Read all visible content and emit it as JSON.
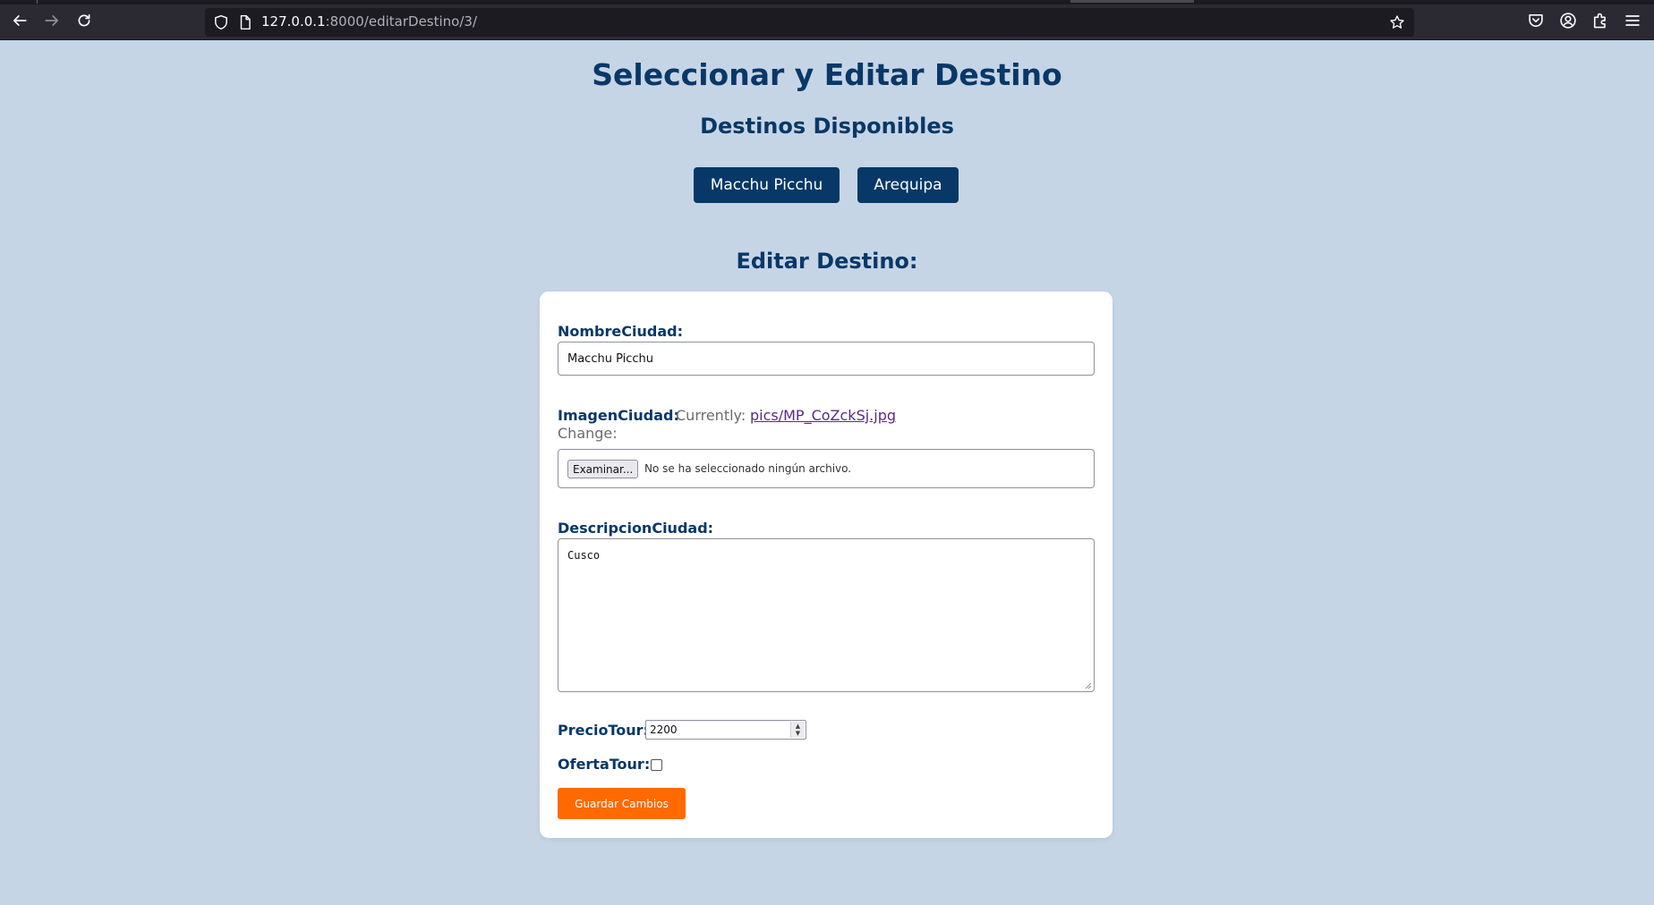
{
  "browser": {
    "url_host": "127.0.0.1",
    "url_rest": ":8000/editarDestino/3/",
    "icons": [
      "back-arrow-icon",
      "forward-arrow-icon",
      "reload-icon",
      "shield-icon",
      "page-icon",
      "bookmark-star-icon",
      "pocket-icon",
      "account-icon",
      "extensions-icon",
      "menu-icon"
    ]
  },
  "page": {
    "title": "Seleccionar y Editar Destino",
    "subtitle": "Destinos Disponibles",
    "destinations": [
      {
        "label": "Macchu Picchu"
      },
      {
        "label": "Arequipa"
      }
    ],
    "edit_heading": "Editar Destino:"
  },
  "form": {
    "nombre_label": "NombreCiudad:",
    "nombre_value": "Macchu Picchu",
    "imagen_label": "ImagenCiudad:",
    "currently_label": "Currently:",
    "current_file": "pics/MP_CoZckSj.jpg",
    "change_label": "Change:",
    "browse_button": "Examinar...",
    "no_file_text": "No se ha seleccionado ningún archivo.",
    "descripcion_label": "DescripcionCiudad:",
    "descripcion_value": "Cusco",
    "precio_label": "PrecioTour:",
    "precio_value": "2200",
    "oferta_label": "OfertaTour:",
    "oferta_checked": false,
    "save_button": "Guardar Cambios"
  },
  "colors": {
    "page_background": "#c6d5e6",
    "primary_navy": "#073868",
    "accent_orange": "#ff6a00",
    "card_background": "#ffffff"
  }
}
